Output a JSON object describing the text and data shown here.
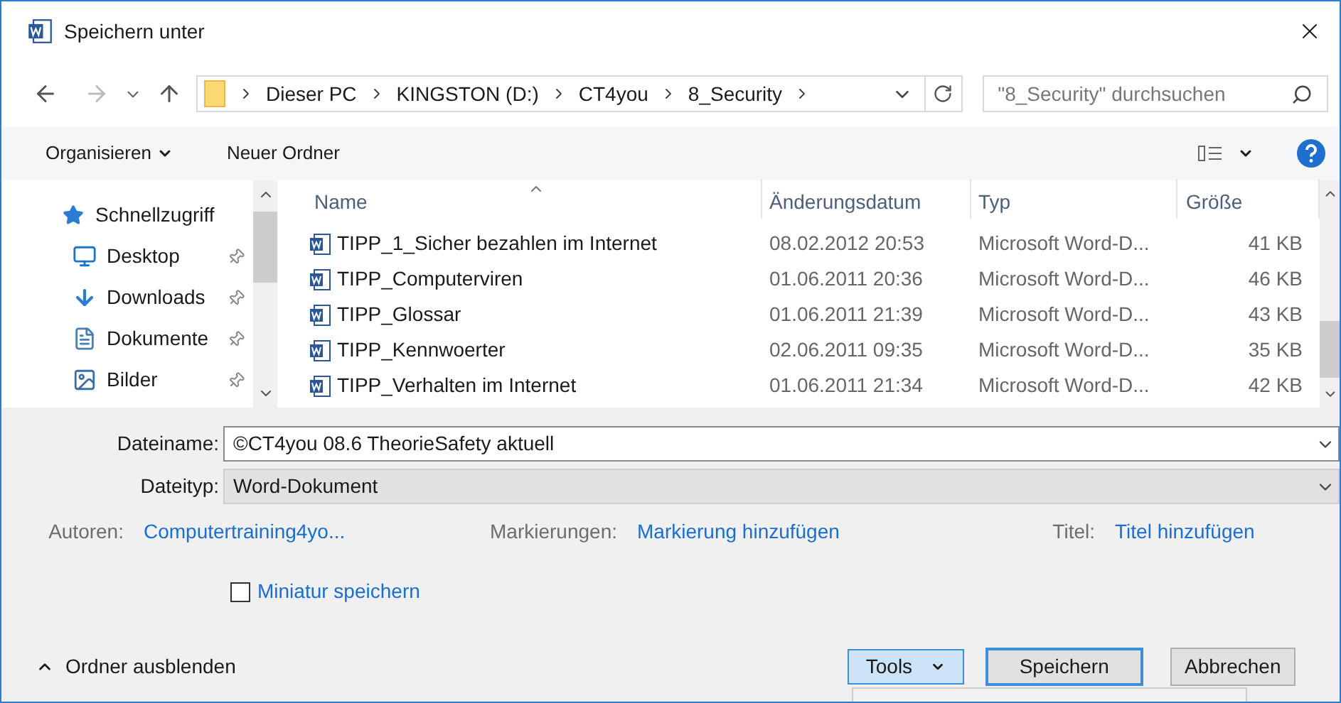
{
  "window": {
    "title": "Speichern unter"
  },
  "address": {
    "crumbs": [
      "Dieser PC",
      "KINGSTON (D:)",
      "CT4you",
      "8_Security"
    ],
    "search_placeholder": "\"8_Security\" durchsuchen"
  },
  "toolbar": {
    "organize": "Organisieren",
    "new_folder": "Neuer Ordner"
  },
  "sidebar": {
    "items": [
      {
        "label": "Schnellzugriff",
        "kind": "star",
        "pinned": false
      },
      {
        "label": "Desktop",
        "kind": "desktop",
        "pinned": true
      },
      {
        "label": "Downloads",
        "kind": "download",
        "pinned": true
      },
      {
        "label": "Dokumente",
        "kind": "document",
        "pinned": true
      },
      {
        "label": "Bilder",
        "kind": "image",
        "pinned": true
      }
    ]
  },
  "table": {
    "columns": [
      "Name",
      "Änderungsdatum",
      "Typ",
      "Größe"
    ],
    "rows": [
      {
        "name": "TIPP_1_Sicher bezahlen im Internet",
        "date": "08.02.2012 20:53",
        "type": "Microsoft Word-D...",
        "size": "41 KB"
      },
      {
        "name": "TIPP_Computerviren",
        "date": "01.06.2011 20:36",
        "type": "Microsoft Word-D...",
        "size": "46 KB"
      },
      {
        "name": "TIPP_Glossar",
        "date": "01.06.2011 21:39",
        "type": "Microsoft Word-D...",
        "size": "43 KB"
      },
      {
        "name": "TIPP_Kennwoerter",
        "date": "02.06.2011 09:35",
        "type": "Microsoft Word-D...",
        "size": "35 KB"
      },
      {
        "name": "TIPP_Verhalten im Internet",
        "date": "01.06.2011 21:34",
        "type": "Microsoft Word-D...",
        "size": "42 KB"
      }
    ]
  },
  "form": {
    "filename_label": "Dateiname:",
    "filename": "©CT4you 08.6 TheorieSafety aktuell",
    "filetype_label": "Dateityp:",
    "filetype": "Word-Dokument",
    "meta": [
      {
        "label": "Autoren:",
        "value": "Computertraining4yo..."
      },
      {
        "label": "Markierungen:",
        "value": "Markierung hinzufügen"
      },
      {
        "label": "Titel:",
        "value": "Titel hinzufügen"
      }
    ],
    "thumbnail": {
      "label": "Miniatur speichern",
      "checked": false
    }
  },
  "footer": {
    "hide_folders": "Ordner ausblenden",
    "tools": "Tools",
    "save": "Speichern",
    "cancel": "Abbrechen"
  }
}
